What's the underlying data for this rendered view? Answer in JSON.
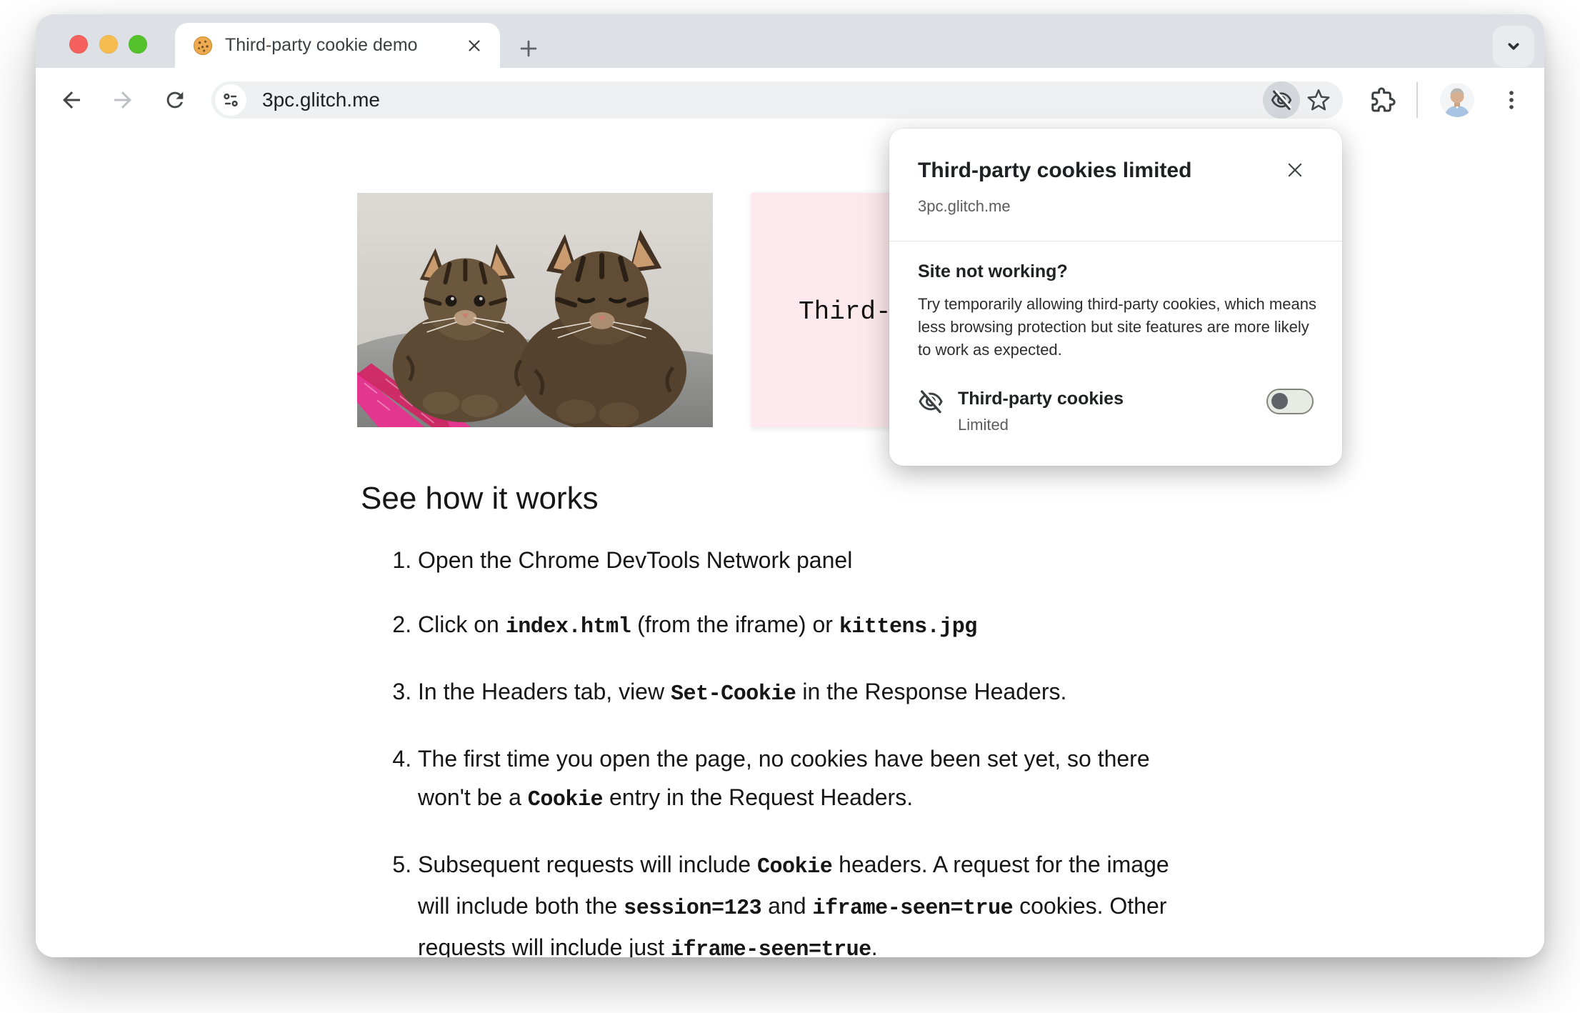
{
  "browser": {
    "tab_title": "Third-party cookie demo",
    "url": "3pc.glitch.me"
  },
  "popup": {
    "title": "Third-party cookies limited",
    "origin": "3pc.glitch.me",
    "section_heading": "Site not working?",
    "description": "Try temporarily allowing third-party cookies, which means less browsing protection but site features are more likely to work as expected.",
    "cookie_label": "Third-party cookies",
    "cookie_status": "Limited",
    "toggle_state": "off"
  },
  "page": {
    "iframe_text": "Third-",
    "heading": "See how it works",
    "steps": [
      [
        {
          "t": "text",
          "v": "Open the Chrome DevTools Network panel"
        }
      ],
      [
        {
          "t": "text",
          "v": "Click on "
        },
        {
          "t": "code",
          "v": "index.html"
        },
        {
          "t": "text",
          "v": " (from the iframe) or "
        },
        {
          "t": "code",
          "v": "kittens.jpg"
        }
      ],
      [
        {
          "t": "text",
          "v": "In the Headers tab, view "
        },
        {
          "t": "code",
          "v": "Set-Cookie"
        },
        {
          "t": "text",
          "v": " in the Response Headers."
        }
      ],
      [
        {
          "t": "text",
          "v": "The first time you open the page, no cookies have been set yet, so there won't be a "
        },
        {
          "t": "code",
          "v": "Cookie"
        },
        {
          "t": "text",
          "v": " entry in the Request Headers."
        }
      ],
      [
        {
          "t": "text",
          "v": "Subsequent requests will include "
        },
        {
          "t": "code",
          "v": "Cookie"
        },
        {
          "t": "text",
          "v": " headers. A request for the image will include both the "
        },
        {
          "t": "code",
          "v": "session=123"
        },
        {
          "t": "text",
          "v": " and "
        },
        {
          "t": "code",
          "v": "iframe-seen=true"
        },
        {
          "t": "text",
          "v": " cookies. Other requests will include just "
        },
        {
          "t": "code",
          "v": "iframe-seen=true"
        },
        {
          "t": "text",
          "v": "."
        }
      ]
    ]
  },
  "colors": {
    "tab_strip_bg": "#dde0e4",
    "iframe_bg": "#fce9ee",
    "omnibox_bg": "#eef0f2",
    "traffic_red": "#f5615c",
    "traffic_yellow": "#f5bd4f",
    "traffic_green": "#53c22b",
    "toggle_track": "#e8eae4",
    "toggle_knob": "#5f6368"
  }
}
